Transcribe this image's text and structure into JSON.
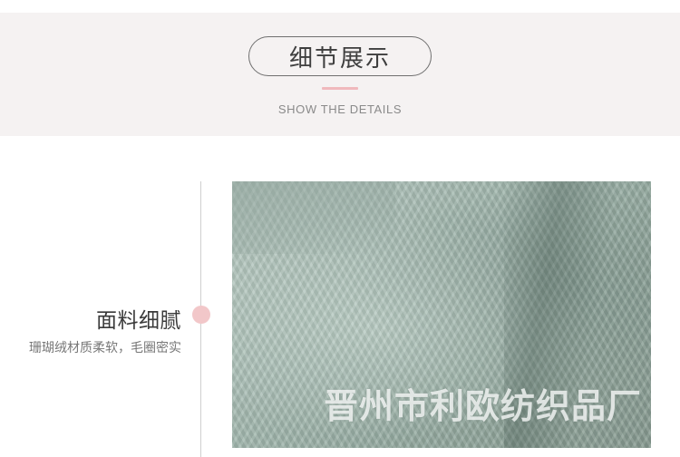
{
  "header": {
    "title": "细节展示",
    "subtitle": "SHOW THE DETAILS"
  },
  "feature": {
    "title": "面料细腻",
    "description": "珊瑚绒材质柔软，毛圈密实"
  },
  "image": {
    "watermark": "晋州市利欧纺织品厂"
  },
  "colors": {
    "header_background": "#f5f2f2",
    "accent_pink": "#f2c7c9",
    "fabric_green": "#a3b8af"
  }
}
